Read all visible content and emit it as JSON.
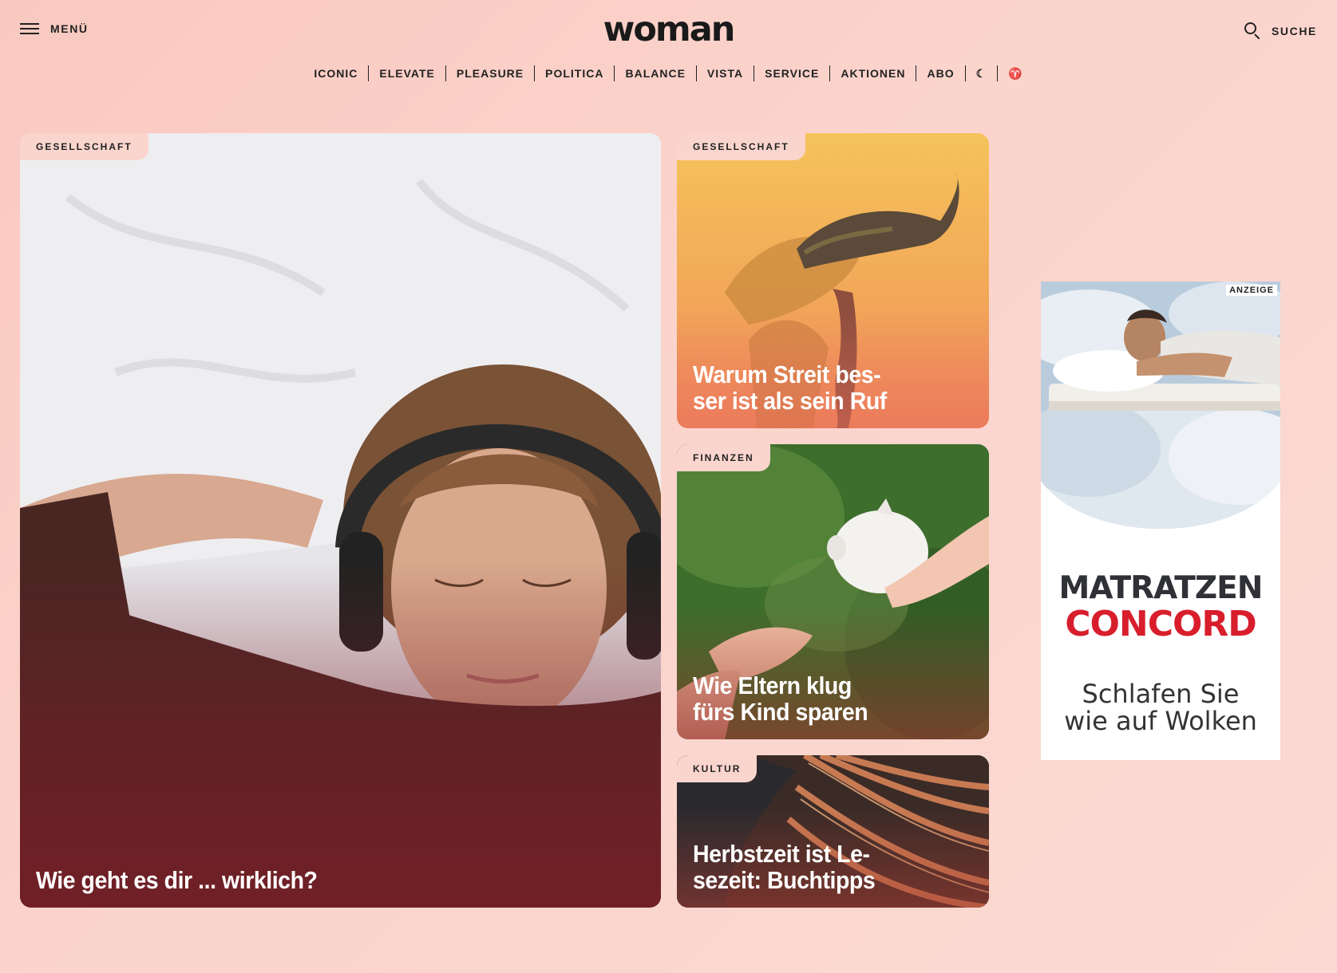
{
  "header": {
    "menu_label": "MENÜ",
    "logo": "woman",
    "search_label": "SUCHE"
  },
  "nav": {
    "items": [
      "ICONIC",
      "ELEVATE",
      "PLEASURE",
      "POLITICA",
      "BALANCE",
      "VISTA",
      "SERVICE",
      "AKTIONEN",
      "ABO"
    ],
    "moon_icon": "☾",
    "aries_icon": "♈"
  },
  "articles": [
    {
      "category": "GESELLSCHAFT",
      "title": "Wie geht es dir ... wirklich?"
    },
    {
      "category": "GESELLSCHAFT",
      "title": "Warum Streit bes-ser ist als sein Ruf",
      "title_lines": [
        "Warum Streit bes-",
        "ser ist als sein Ruf"
      ]
    },
    {
      "category": "FINANZEN",
      "title": "Wie Eltern klug fürs Kind sparen",
      "title_lines": [
        "Wie Eltern klug",
        "fürs Kind sparen"
      ]
    },
    {
      "category": "KULTUR",
      "title": "Herbstzeit ist Le-sezeit: Buchtipps",
      "title_lines": [
        "Herbstzeit ist Le-",
        "sezeit: Buchtipps"
      ]
    }
  ],
  "ad": {
    "label": "ANZEIGE",
    "brand_line1": "MATRATZEN",
    "brand_line2": "CONCORD",
    "slogan_line1": "Schlafen Sie",
    "slogan_line2": "wie auf Wolken",
    "brand_red": "#d81e2c"
  }
}
